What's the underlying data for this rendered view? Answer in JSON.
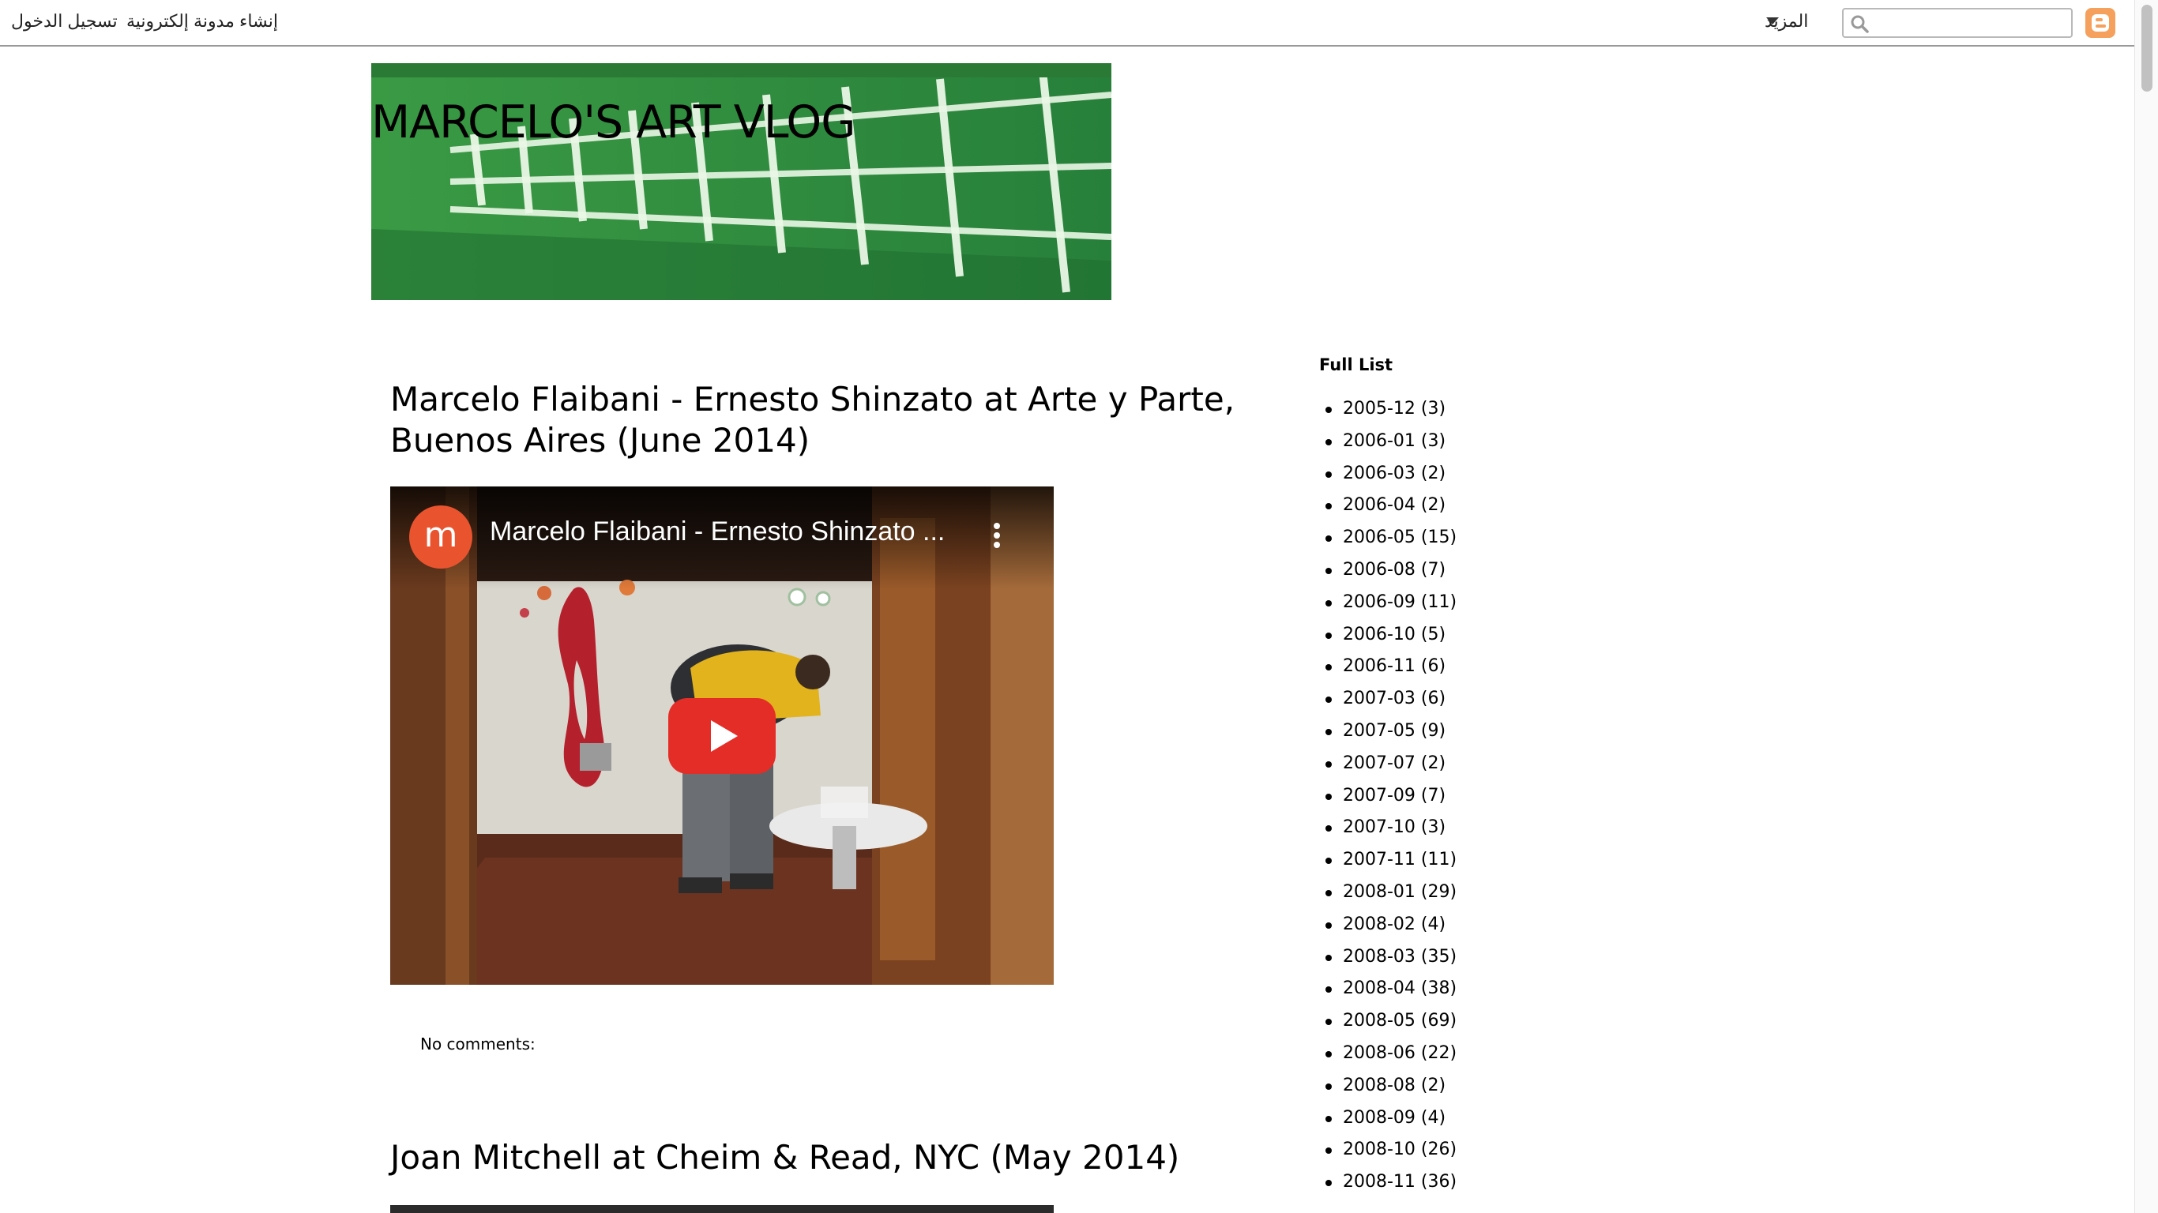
{
  "navbar": {
    "signin_label": "تسجيل الدخول",
    "create_blog_label": "إنشاء مدونة إلكترونية",
    "more_label": "المزيد",
    "search_value": ""
  },
  "header": {
    "blog_title": "Marcelo's Art Vlog"
  },
  "posts": [
    {
      "title": "Marcelo Flaibani - Ernesto Shinzato at Arte y Parte, Buenos Aires (June 2014)",
      "video": {
        "channel_initial": "m",
        "title": "Marcelo Flaibani - Ernesto Shinzato ..."
      },
      "comments_label": "No comments:"
    },
    {
      "title": "Joan Mitchell at Cheim & Read, NYC (May 2014)"
    }
  ],
  "sidebar": {
    "title": "Full List",
    "archive": [
      {
        "month": "2005-12",
        "count": "(3)"
      },
      {
        "month": "2006-01",
        "count": "(3)"
      },
      {
        "month": "2006-03",
        "count": "(2)"
      },
      {
        "month": "2006-04",
        "count": "(2)"
      },
      {
        "month": "2006-05",
        "count": "(15)"
      },
      {
        "month": "2006-08",
        "count": "(7)"
      },
      {
        "month": "2006-09",
        "count": "(11)"
      },
      {
        "month": "2006-10",
        "count": "(5)"
      },
      {
        "month": "2006-11",
        "count": "(6)"
      },
      {
        "month": "2007-03",
        "count": "(6)"
      },
      {
        "month": "2007-05",
        "count": "(9)"
      },
      {
        "month": "2007-07",
        "count": "(2)"
      },
      {
        "month": "2007-09",
        "count": "(7)"
      },
      {
        "month": "2007-10",
        "count": "(3)"
      },
      {
        "month": "2007-11",
        "count": "(11)"
      },
      {
        "month": "2008-01",
        "count": "(29)"
      },
      {
        "month": "2008-02",
        "count": "(4)"
      },
      {
        "month": "2008-03",
        "count": "(35)"
      },
      {
        "month": "2008-04",
        "count": "(38)"
      },
      {
        "month": "2008-05",
        "count": "(69)"
      },
      {
        "month": "2008-06",
        "count": "(22)"
      },
      {
        "month": "2008-08",
        "count": "(2)"
      },
      {
        "month": "2008-09",
        "count": "(4)"
      },
      {
        "month": "2008-10",
        "count": "(26)"
      },
      {
        "month": "2008-11",
        "count": "(36)"
      }
    ]
  },
  "colors": {
    "banner_green": "#2f8f3f",
    "blogger_orange": "#f5a05c",
    "youtube_red": "#e52d27"
  },
  "icons": [
    "blogger-logo-icon",
    "search-icon",
    "caret-down-icon",
    "video-menu-icon",
    "play-button-icon"
  ]
}
